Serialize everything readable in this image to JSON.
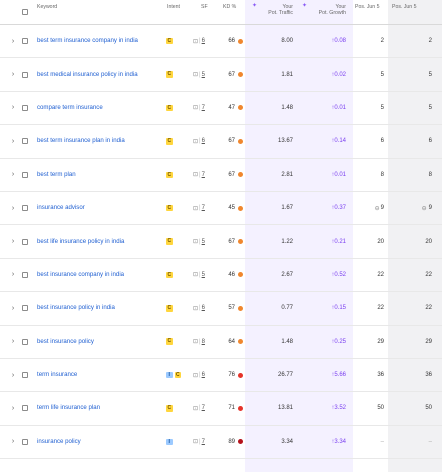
{
  "headers": {
    "keyword": "Keyword",
    "intent": "Intent",
    "sf": "SF",
    "kd": "KD %",
    "traffic_l1": "Your",
    "traffic_l2": "Pot. Traffic",
    "growth_l1": "Your",
    "growth_l2": "Pot. Growth",
    "pos_a": "Pos. Jun 5",
    "pos_b": "Pos. Jun 5",
    "ai_icon": "sparkle-icon"
  },
  "colors": {
    "kd_orange": "#f0872e",
    "kd_red": "#e5332a",
    "kd_darkred": "#b5121b",
    "link": "#1f5fd1",
    "growth": "#7a3ff0"
  },
  "rows": [
    {
      "keyword": "best term insurance company in india",
      "intents": [
        "C"
      ],
      "sf": "6",
      "kd": "66",
      "kd_color": "#f0872e",
      "traffic": "8.00",
      "growth": "↑0.08",
      "pos_a": "2",
      "pos_b": "2",
      "feature": ""
    },
    {
      "keyword": "best medical insurance policy in india",
      "intents": [
        "C"
      ],
      "sf": "5",
      "kd": "67",
      "kd_color": "#f0872e",
      "traffic": "1.81",
      "growth": "↑0.02",
      "pos_a": "5",
      "pos_b": "5",
      "feature": ""
    },
    {
      "keyword": "compare term insurance",
      "intents": [
        "C"
      ],
      "sf": "7",
      "kd": "47",
      "kd_color": "#f0872e",
      "traffic": "1.48",
      "growth": "↑0.01",
      "pos_a": "5",
      "pos_b": "5",
      "feature": ""
    },
    {
      "keyword": "best term insurance plan in india",
      "intents": [
        "C"
      ],
      "sf": "6",
      "kd": "67",
      "kd_color": "#f0872e",
      "traffic": "13.67",
      "growth": "↑0.14",
      "pos_a": "6",
      "pos_b": "6",
      "feature": ""
    },
    {
      "keyword": "best term plan",
      "intents": [
        "C"
      ],
      "sf": "7",
      "kd": "67",
      "kd_color": "#f0872e",
      "traffic": "2.81",
      "growth": "↑0.01",
      "pos_a": "8",
      "pos_b": "8",
      "feature": ""
    },
    {
      "keyword": "insurance advisor",
      "intents": [
        "C"
      ],
      "sf": "7",
      "kd": "45",
      "kd_color": "#f0872e",
      "traffic": "1.67",
      "growth": "↑0.37",
      "pos_a": "9",
      "pos_b": "9",
      "feature": "link"
    },
    {
      "keyword": "best life insurance policy in india",
      "intents": [
        "C"
      ],
      "sf": "5",
      "kd": "67",
      "kd_color": "#f0872e",
      "traffic": "1.22",
      "growth": "↑0.21",
      "pos_a": "20",
      "pos_b": "20",
      "feature": ""
    },
    {
      "keyword": "best insurance company in india",
      "intents": [
        "C"
      ],
      "sf": "5",
      "kd": "46",
      "kd_color": "#f0872e",
      "traffic": "2.67",
      "growth": "↑0.52",
      "pos_a": "22",
      "pos_b": "22",
      "feature": ""
    },
    {
      "keyword": "best insurance policy in india",
      "intents": [
        "C"
      ],
      "sf": "6",
      "kd": "57",
      "kd_color": "#f0872e",
      "traffic": "0.77",
      "growth": "↑0.15",
      "pos_a": "22",
      "pos_b": "22",
      "feature": ""
    },
    {
      "keyword": "best insurance policy",
      "intents": [
        "C"
      ],
      "sf": "8",
      "kd": "64",
      "kd_color": "#f0872e",
      "traffic": "1.48",
      "growth": "↑0.25",
      "pos_a": "29",
      "pos_b": "29",
      "feature": ""
    },
    {
      "keyword": "term insurance",
      "intents": [
        "I",
        "C"
      ],
      "sf": "6",
      "kd": "76",
      "kd_color": "#e5332a",
      "traffic": "26.77",
      "growth": "↑5.66",
      "pos_a": "36",
      "pos_b": "36",
      "feature": ""
    },
    {
      "keyword": "term life insurance plan",
      "intents": [
        "C"
      ],
      "sf": "7",
      "kd": "71",
      "kd_color": "#e5332a",
      "traffic": "13.81",
      "growth": "↑3.52",
      "pos_a": "50",
      "pos_b": "50",
      "feature": ""
    },
    {
      "keyword": "insurance policy",
      "intents": [
        "I"
      ],
      "sf": "7",
      "kd": "89",
      "kd_color": "#b5121b",
      "traffic": "3.34",
      "growth": "↑3.34",
      "pos_a": "",
      "pos_b": "",
      "pos_a_icon": "dash",
      "pos_b_icon": "dash",
      "feature": ""
    }
  ]
}
